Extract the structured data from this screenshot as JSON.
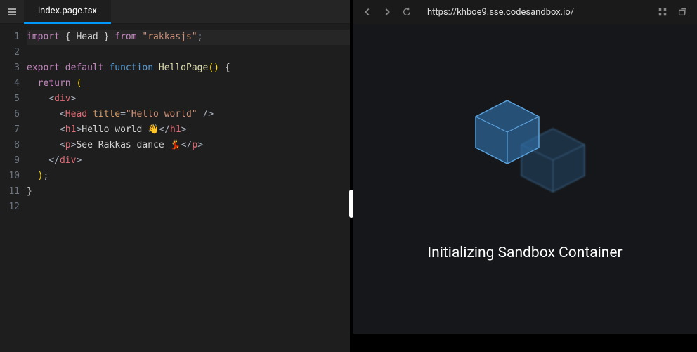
{
  "editor": {
    "tab_filename": "index.page.tsx",
    "lines": [
      {
        "n": 1,
        "hl": true,
        "tokens": [
          {
            "t": "import",
            "c": "tok-kw"
          },
          {
            "t": " ",
            "c": ""
          },
          {
            "t": "{ Head }",
            "c": "tok-brace"
          },
          {
            "t": " ",
            "c": ""
          },
          {
            "t": "from",
            "c": "tok-kw"
          },
          {
            "t": " ",
            "c": ""
          },
          {
            "t": "\"rakkasjs\"",
            "c": "tok-str"
          },
          {
            "t": ";",
            "c": "tok-punc"
          }
        ]
      },
      {
        "n": 2,
        "tokens": []
      },
      {
        "n": 3,
        "tokens": [
          {
            "t": "export",
            "c": "tok-kw"
          },
          {
            "t": " ",
            "c": ""
          },
          {
            "t": "default",
            "c": "tok-kw"
          },
          {
            "t": " ",
            "c": ""
          },
          {
            "t": "function",
            "c": "tok-fn"
          },
          {
            "t": " ",
            "c": ""
          },
          {
            "t": "HelloPage",
            "c": "tok-name"
          },
          {
            "t": "()",
            "c": "tok-paren"
          },
          {
            "t": " ",
            "c": ""
          },
          {
            "t": "{",
            "c": "tok-brace"
          }
        ]
      },
      {
        "n": 4,
        "tokens": [
          {
            "t": "  ",
            "c": ""
          },
          {
            "t": "return",
            "c": "tok-kw"
          },
          {
            "t": " ",
            "c": ""
          },
          {
            "t": "(",
            "c": "tok-paren"
          }
        ]
      },
      {
        "n": 5,
        "tokens": [
          {
            "t": "    ",
            "c": ""
          },
          {
            "t": "<",
            "c": "tok-punc"
          },
          {
            "t": "div",
            "c": "tok-tag"
          },
          {
            "t": ">",
            "c": "tok-punc"
          }
        ]
      },
      {
        "n": 6,
        "tokens": [
          {
            "t": "      ",
            "c": ""
          },
          {
            "t": "<",
            "c": "tok-punc"
          },
          {
            "t": "Head",
            "c": "tok-tag"
          },
          {
            "t": " ",
            "c": ""
          },
          {
            "t": "title",
            "c": "tok-attr"
          },
          {
            "t": "=",
            "c": "tok-punc"
          },
          {
            "t": "\"Hello world\"",
            "c": "tok-str"
          },
          {
            "t": " />",
            "c": "tok-punc"
          }
        ]
      },
      {
        "n": 7,
        "tokens": [
          {
            "t": "      ",
            "c": ""
          },
          {
            "t": "<",
            "c": "tok-punc"
          },
          {
            "t": "h1",
            "c": "tok-tag"
          },
          {
            "t": ">",
            "c": "tok-punc"
          },
          {
            "t": "Hello world 👋",
            "c": ""
          },
          {
            "t": "</",
            "c": "tok-punc"
          },
          {
            "t": "h1",
            "c": "tok-tag"
          },
          {
            "t": ">",
            "c": "tok-punc"
          }
        ]
      },
      {
        "n": 8,
        "tokens": [
          {
            "t": "      ",
            "c": ""
          },
          {
            "t": "<",
            "c": "tok-punc"
          },
          {
            "t": "p",
            "c": "tok-tag"
          },
          {
            "t": ">",
            "c": "tok-punc"
          },
          {
            "t": "See Rakkas dance 💃",
            "c": ""
          },
          {
            "t": "</",
            "c": "tok-punc"
          },
          {
            "t": "p",
            "c": "tok-tag"
          },
          {
            "t": ">",
            "c": "tok-punc"
          }
        ]
      },
      {
        "n": 9,
        "tokens": [
          {
            "t": "    ",
            "c": ""
          },
          {
            "t": "</",
            "c": "tok-punc"
          },
          {
            "t": "div",
            "c": "tok-tag"
          },
          {
            "t": ">",
            "c": "tok-punc"
          }
        ]
      },
      {
        "n": 10,
        "tokens": [
          {
            "t": "  ",
            "c": ""
          },
          {
            "t": ")",
            "c": "tok-paren"
          },
          {
            "t": ";",
            "c": "tok-punc"
          }
        ]
      },
      {
        "n": 11,
        "tokens": [
          {
            "t": "}",
            "c": "tok-brace"
          }
        ]
      },
      {
        "n": 12,
        "tokens": []
      }
    ]
  },
  "browser": {
    "url": "https://khboe9.sse.codesandbox.io/"
  },
  "preview": {
    "status_text": "Initializing Sandbox Container"
  },
  "colors": {
    "accent": "#0097fb",
    "cube_fill": "#2f6ea8",
    "cube_stroke": "#5aa2de"
  }
}
